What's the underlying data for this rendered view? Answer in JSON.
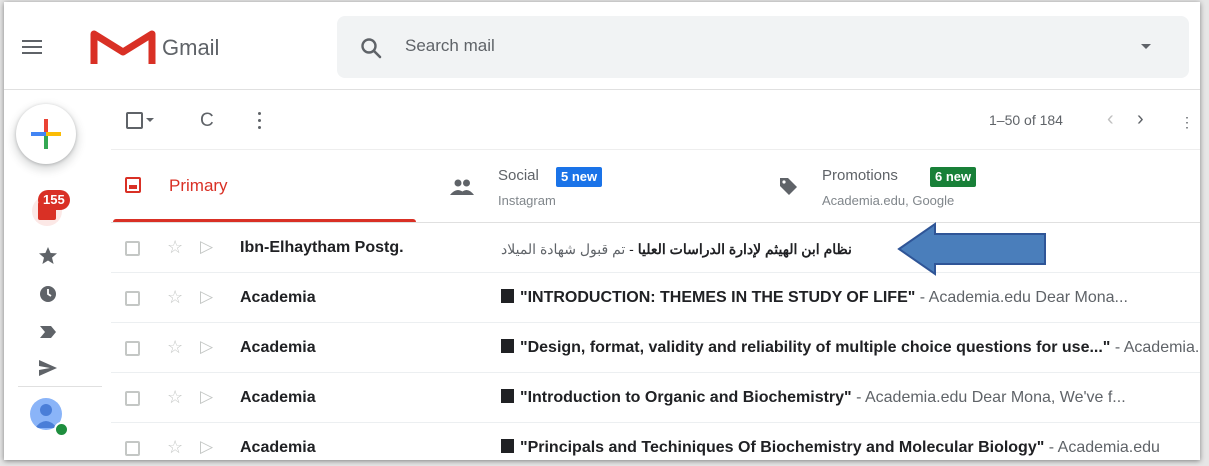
{
  "header": {
    "app_name": "Gmail",
    "search_placeholder": "Search mail"
  },
  "rail": {
    "inbox_badge": "155"
  },
  "toolbar": {
    "pagination": "1–50 of 184",
    "refresh_glyph": "C",
    "prev_glyph": "‹",
    "next_glyph": "›",
    "extra_glyph": "⋮"
  },
  "tabs": [
    {
      "label": "Primary",
      "color": "#d93025"
    },
    {
      "label": "Social",
      "badge": "5 new",
      "badge_color": "#1a73e8",
      "sub": "Instagram"
    },
    {
      "label": "Promotions",
      "badge": "6 new",
      "badge_color": "#188038",
      "sub": "Academia.edu, Google"
    }
  ],
  "emails": [
    {
      "sender": "Ibn-Elhaytham Postg.",
      "subject_bold": "نظام ابن الهيثم لإدارة الدراسات العليا",
      "separator": " - ",
      "snippet": "تم قبول شهادة الميلاد"
    },
    {
      "sender": "Academia",
      "subject": "\"INTRODUCTION: THEMES IN THE STUDY OF LIFE\"",
      "snippet": " - Academia.edu Dear Mona..."
    },
    {
      "sender": "Academia",
      "subject": "\"Design, format, validity and reliability of multiple choice questions for use...\"",
      "snippet": " - Academia.edu"
    },
    {
      "sender": "Academia",
      "subject": "\"Introduction to Organic and Biochemistry\"",
      "snippet": " - Academia.edu Dear Mona, We've f..."
    },
    {
      "sender": "Academia",
      "subject": "\"Principals and Techiniques Of Biochemistry and Molecular Biology\"",
      "snippet": " - Academia.edu"
    }
  ],
  "colors": {
    "accent_red": "#d93025",
    "arrow_fill": "#4a7ebb",
    "arrow_stroke": "#2f5597"
  }
}
